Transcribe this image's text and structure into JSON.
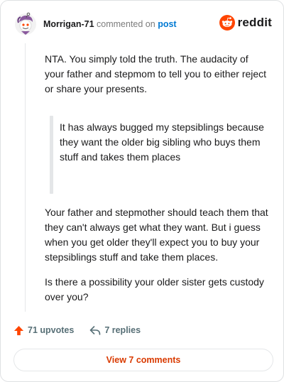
{
  "header": {
    "username": "Morrigan-71",
    "action_text": "commented on",
    "post_link": "post",
    "brand": "reddit"
  },
  "comment": {
    "paragraph_1": "NTA. You simply told the truth. The audacity of your father and stepmom to tell you to either reject or share your presents.",
    "quote": "It has always bugged my stepsiblings because they want the older big sibling who buys them stuff and takes them places",
    "paragraph_2": "Your father and stepmother should teach them that they can't always get what they want. But i guess when you get older they'll expect you to buy your stepsiblings stuff and take them places.",
    "paragraph_3": "Is there a possibility your older sister gets custody over you?"
  },
  "actions": {
    "upvotes": "71 upvotes",
    "replies": "7 replies"
  },
  "footer": {
    "view_comments": "View 7 comments"
  },
  "colors": {
    "accent": "#ff4500",
    "link": "#0079d3",
    "button_text": "#d93a00"
  },
  "icons": {
    "avatar": "snoo-avatar",
    "brand": "reddit-logo",
    "upvote": "upvote-arrow",
    "reply": "reply-arrow"
  }
}
